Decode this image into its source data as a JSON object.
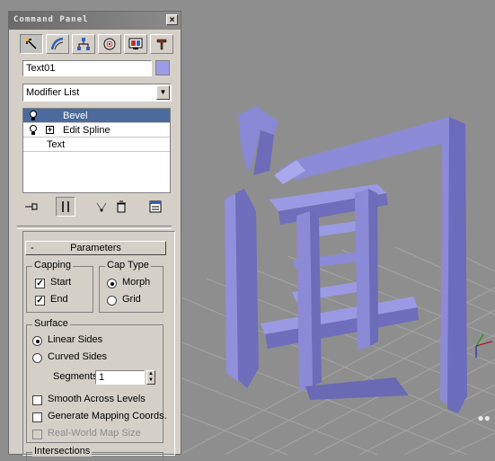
{
  "panel": {
    "title": "Command Panel",
    "close_glyph": "×",
    "tabs": [
      {
        "icon": "create-icon",
        "active": true
      },
      {
        "icon": "modify-icon",
        "active": false
      },
      {
        "icon": "hierarchy-icon",
        "active": false
      },
      {
        "icon": "motion-icon",
        "active": false
      },
      {
        "icon": "display-icon",
        "active": false
      },
      {
        "icon": "utilities-icon",
        "active": false
      }
    ],
    "object_name": "Text01",
    "object_color": "#9c9ce6",
    "modifier_list_label": "Modifier List",
    "stack": [
      {
        "label": "Bevel",
        "selected": true
      },
      {
        "label": "Edit Spline",
        "expand": "+"
      },
      {
        "label": "Text"
      }
    ]
  },
  "parameters": {
    "rollout_minus": "-",
    "rollout_title": "Parameters",
    "capping": {
      "title": "Capping",
      "start_label": "Start",
      "start_checked": true,
      "end_label": "End",
      "end_checked": true
    },
    "cap_type": {
      "title": "Cap Type",
      "morph_label": "Morph",
      "grid_label": "Grid",
      "selected": "Morph"
    },
    "surface": {
      "title": "Surface",
      "linear_label": "Linear Sides",
      "curved_label": "Curved Sides",
      "selected": "Linear Sides",
      "segments_label": "Segments:",
      "segments_value": "1",
      "smooth_label": "Smooth Across Levels",
      "mapping_label": "Generate Mapping Coords.",
      "realworld_label": "Real-World Map Size"
    },
    "next_group": "Intersections"
  },
  "viewport": {
    "object_color": "#8a8ad6",
    "grid_color": "#a0a0a0",
    "background": "#8e8e8e"
  }
}
